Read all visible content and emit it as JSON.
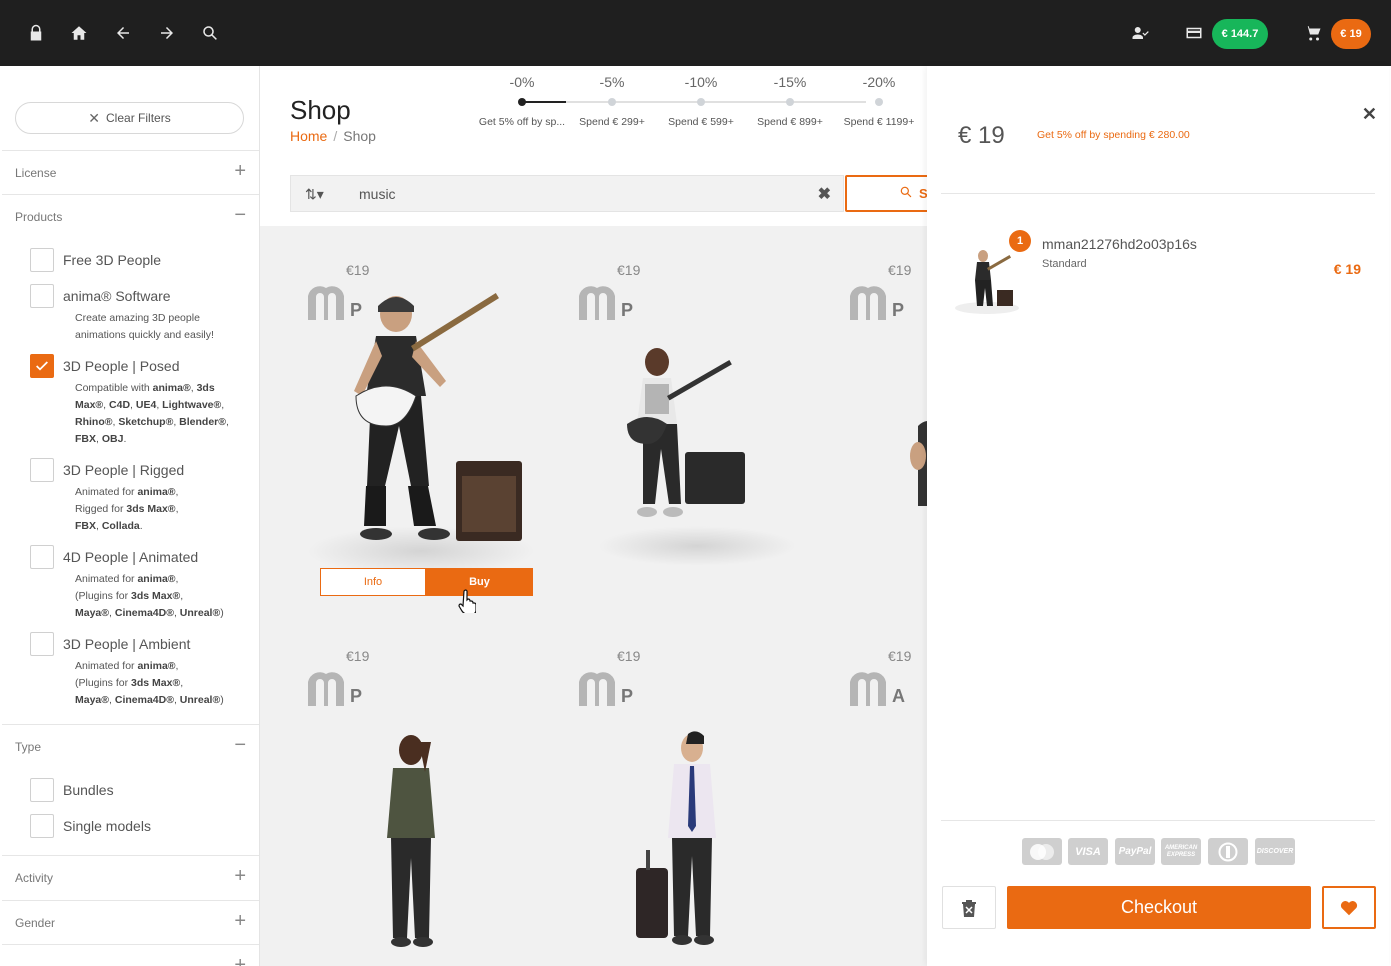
{
  "topbar": {
    "icons": [
      "lock-icon",
      "home-icon",
      "back-arrow-icon",
      "forward-arrow-icon",
      "search-icon",
      "user-check-icon",
      "credit-card-icon",
      "cart-icon"
    ],
    "credit_balance": "€ 144.7",
    "cart_total": "€ 19"
  },
  "sidebar": {
    "clear_filters": "Clear Filters",
    "sections": {
      "license": "License",
      "products": "Products",
      "type": "Type",
      "activity": "Activity",
      "gender": "Gender"
    },
    "products": [
      {
        "label": "Free 3D People",
        "checked": false
      },
      {
        "label": "anima® Software",
        "checked": false,
        "desc": "Create amazing 3D people animations quickly and easily!"
      },
      {
        "label": "3D People | Posed",
        "checked": true
      },
      {
        "label": "3D People | Rigged",
        "checked": false
      },
      {
        "label": "4D People | Animated",
        "checked": false
      },
      {
        "label": "3D People | Ambient",
        "checked": false
      }
    ],
    "type": [
      {
        "label": "Bundles",
        "checked": false
      },
      {
        "label": "Single models",
        "checked": false
      }
    ]
  },
  "main": {
    "title": "Shop",
    "breadcrumb": {
      "home": "Home",
      "sep": "/",
      "current": "Shop"
    },
    "discounts": [
      {
        "pct": "-0%",
        "label": "Get 5% off by sp..."
      },
      {
        "pct": "-5%",
        "label": "Spend € 299+"
      },
      {
        "pct": "-10%",
        "label": "Spend € 599+"
      },
      {
        "pct": "-15%",
        "label": "Spend € 899+"
      },
      {
        "pct": "-20%",
        "label": "Spend € 1199+"
      }
    ],
    "search": {
      "query": "music",
      "button_label": "S"
    },
    "products": [
      {
        "price": "€19",
        "letter": "P"
      },
      {
        "price": "€19",
        "letter": "P"
      },
      {
        "price": "€19",
        "letter": "P"
      },
      {
        "price": "€19",
        "letter": "P"
      },
      {
        "price": "€19",
        "letter": "P"
      },
      {
        "price": "€19",
        "letter": "A"
      }
    ],
    "card_buttons": {
      "info": "Info",
      "buy": "Buy"
    }
  },
  "cart": {
    "total": "€ 19",
    "hint": "Get 5% off by spending € 280.00",
    "item": {
      "qty": "1",
      "name": "mman21276hd2o03p16s",
      "license": "Standard",
      "price": "€ 19"
    },
    "payments": [
      "MasterCard",
      "VISA",
      "PayPal",
      "AMERICAN EXPRESS",
      "Diners",
      "DISCOVER"
    ],
    "checkout_label": "Checkout"
  },
  "colors": {
    "accent": "#ea6a12",
    "credit": "#17b65a",
    "topbar": "#1f1f1f"
  }
}
